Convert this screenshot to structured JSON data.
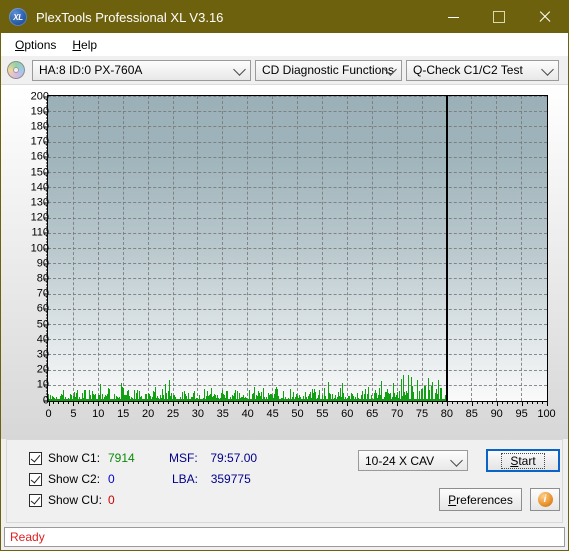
{
  "window": {
    "title": "PlexTools Professional XL V3.16",
    "app_icon": "xl-disc-icon",
    "minimize_label": "–",
    "maximize_label": "□",
    "close_label": "✕"
  },
  "menubar": {
    "items": [
      {
        "label": "Options",
        "accel": "O"
      },
      {
        "label": "Help",
        "accel": "H"
      }
    ]
  },
  "toolbar": {
    "drive_icon": "disc-drive-icon",
    "drive_select": "HA:8 ID:0  PX-760A",
    "function_select": "CD Diagnostic Functions",
    "test_select": "Q-Check C1/C2 Test"
  },
  "legend": {
    "c1": {
      "label": "Show C1:",
      "value": "7914",
      "color": "#0a8a0a",
      "checked": true
    },
    "c2": {
      "label": "Show C2:",
      "value": "0",
      "color": "#0000cc",
      "checked": true
    },
    "cu": {
      "label": "Show CU:",
      "value": "0",
      "color": "#cc0000",
      "checked": true
    }
  },
  "readouts": {
    "msf_label": "MSF:",
    "msf_value": "79:57.00",
    "lba_label": "LBA:",
    "lba_value": "359775"
  },
  "controls": {
    "speed_select": "10-24 X CAV",
    "start_button": "Start",
    "preferences_button": "Preferences",
    "info_button": "i"
  },
  "statusbar": {
    "text": "Ready",
    "color": "#e02020"
  },
  "chart_data": {
    "type": "bar",
    "title": "",
    "xlabel": "",
    "ylabel": "",
    "xlim": [
      0,
      100
    ],
    "ylim": [
      0,
      200
    ],
    "xticks": [
      0,
      5,
      10,
      15,
      20,
      25,
      30,
      35,
      40,
      45,
      50,
      55,
      60,
      65,
      70,
      75,
      80,
      85,
      90,
      95,
      100
    ],
    "yticks": [
      0,
      10,
      20,
      30,
      40,
      50,
      60,
      70,
      80,
      90,
      100,
      110,
      120,
      130,
      140,
      150,
      160,
      170,
      180,
      190,
      200
    ],
    "grid": true,
    "legend_position": "below-plot",
    "series": [
      {
        "name": "C1",
        "color": "#11a013",
        "total": 7914,
        "data_end_x": 80,
        "x": [
          0.4,
          0.9,
          1.4,
          1.9,
          2.4,
          2.9,
          3.4,
          3.9,
          4.4,
          4.9,
          5.4,
          5.9,
          6.4,
          6.9,
          7.4,
          7.9,
          8.4,
          8.9,
          9.4,
          9.9,
          10.4,
          10.9,
          11.4,
          11.9,
          12.4,
          12.9,
          13.4,
          13.9,
          14.4,
          14.9,
          15.4,
          15.9,
          16.4,
          16.9,
          17.4,
          17.9,
          18.4,
          18.9,
          19.4,
          19.9,
          20.4,
          20.9,
          21.4,
          21.9,
          22.4,
          22.9,
          23.4,
          23.9,
          24.4,
          24.9,
          25.4,
          25.9,
          26.4,
          26.9,
          27.4,
          27.9,
          28.4,
          28.9,
          29.4,
          29.9,
          30.4,
          30.9,
          31.4,
          31.9,
          32.4,
          32.9,
          33.4,
          33.9,
          34.4,
          34.9,
          35.4,
          35.9,
          36.4,
          36.9,
          37.4,
          37.9,
          38.4,
          38.9,
          39.4,
          39.9,
          40.4,
          40.9,
          41.4,
          41.9,
          42.4,
          42.9,
          43.4,
          43.9,
          44.4,
          44.9,
          45.4,
          45.9,
          46.4,
          46.9,
          47.4,
          47.9,
          48.4,
          48.9,
          49.4,
          49.9,
          50.4,
          50.9,
          51.4,
          51.9,
          52.4,
          52.9,
          53.4,
          53.9,
          54.4,
          54.9,
          55.4,
          55.9,
          56.4,
          56.9,
          57.4,
          57.9,
          58.4,
          58.9,
          59.4,
          59.9,
          60.4,
          60.9,
          61.4,
          61.9,
          62.4,
          62.9,
          63.4,
          63.9,
          64.4,
          64.9,
          65.4,
          65.9,
          66.4,
          66.9,
          67.4,
          67.9,
          68.4,
          68.9,
          69.4,
          69.9,
          70.4,
          70.9,
          71.4,
          71.9,
          72.4,
          72.9,
          73.4,
          73.9,
          74.4,
          74.9,
          75.4,
          75.9,
          76.4,
          76.9,
          77.4,
          77.9,
          78.4,
          78.9,
          79.4,
          79.9
        ],
        "values": [
          3,
          5,
          4,
          6,
          3,
          5,
          7,
          4,
          3,
          6,
          5,
          8,
          4,
          3,
          5,
          6,
          4,
          7,
          5,
          3,
          6,
          9,
          4,
          5,
          7,
          4,
          3,
          6,
          5,
          8,
          10,
          4,
          5,
          3,
          6,
          7,
          4,
          5,
          9,
          3,
          4,
          6,
          5,
          7,
          4,
          3,
          8,
          5,
          6,
          4,
          3,
          5,
          7,
          4,
          6,
          3,
          5,
          8,
          4,
          6,
          5,
          3,
          7,
          4,
          6,
          9,
          5,
          3,
          4,
          7,
          5,
          6,
          3,
          4,
          8,
          5,
          4,
          6,
          3,
          5,
          7,
          4,
          6,
          3,
          5,
          4,
          8,
          6,
          3,
          5,
          4,
          7,
          5,
          3,
          6,
          4,
          5,
          8,
          4,
          3,
          6,
          5,
          7,
          4,
          3,
          5,
          6,
          4,
          7,
          3,
          5,
          4,
          6,
          8,
          3,
          5,
          4,
          7,
          5,
          3,
          6,
          4,
          5,
          7,
          3,
          4,
          6,
          5,
          8,
          4,
          3,
          6,
          5,
          9,
          4,
          7,
          5,
          3,
          6,
          4,
          8,
          11,
          6,
          9,
          7,
          12,
          10,
          8,
          13,
          9,
          7,
          15,
          10,
          8,
          18,
          12,
          9,
          7,
          6,
          4
        ]
      },
      {
        "name": "C2",
        "color": "#0000cc",
        "total": 0,
        "values": []
      },
      {
        "name": "CU",
        "color": "#cc0000",
        "total": 0,
        "values": []
      }
    ]
  }
}
